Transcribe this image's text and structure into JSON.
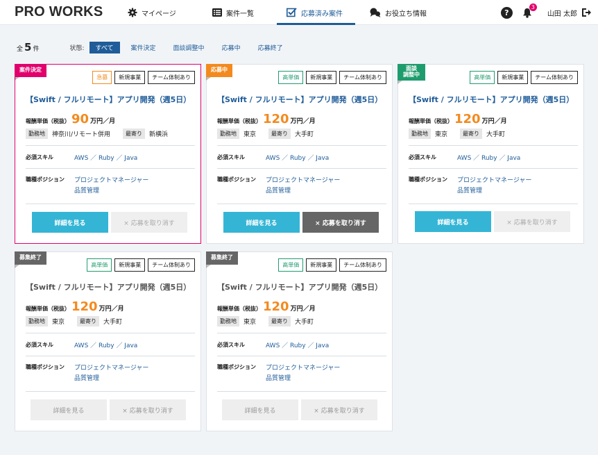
{
  "header": {
    "logo": "PRO WORKS",
    "nav": [
      {
        "label": "マイページ"
      },
      {
        "label": "案件一覧"
      },
      {
        "label": "応募済み案件"
      },
      {
        "label": "お役立ち情報"
      }
    ],
    "notification_count": "3",
    "user_name": "山田 太郎",
    "colors": {
      "accent": "#1f5c99",
      "alert": "#e2006d"
    }
  },
  "filter": {
    "total_prefix": "全",
    "total_count": "5",
    "total_suffix": "件",
    "status_label": "状態:",
    "chips": [
      "すべて",
      "案件決定",
      "面談調整中",
      "応募中",
      "応募終了"
    ]
  },
  "cards": [
    {
      "status": "案件決定",
      "tags": [
        "急募",
        "新規事業",
        "チーム体制あり"
      ],
      "title": "【Swift / フルリモート】アプリ開発（週5日）",
      "price_label": "報酬単価（税抜）",
      "price": "90",
      "price_unit": "万円／月",
      "location_label": "勤務地",
      "location": "神奈川/リモート併用",
      "station_label": "最寄り",
      "station": "新横浜",
      "skills_label": "必須スキル",
      "skills": "AWS ／ Ruby ／ Java",
      "position_label": "職種ポジション",
      "position1": "プロジェクトマネージャー",
      "position2": "品質管理",
      "detail_button": "詳細を見る",
      "cancel_button": "× 応募を取り消す"
    },
    {
      "status": "応募中",
      "tags": [
        "高単価",
        "新規事業",
        "チーム体制あり"
      ],
      "title": "【Swift / フルリモート】アプリ開発（週5日）",
      "price_label": "報酬単価（税抜）",
      "price": "120",
      "price_unit": "万円／月",
      "location_label": "勤務地",
      "location": "東京",
      "station_label": "最寄り",
      "station": "大手町",
      "skills_label": "必須スキル",
      "skills": "AWS ／ Ruby ／ Java",
      "position_label": "職種ポジション",
      "position1": "プロジェクトマネージャー",
      "position2": "品質管理",
      "detail_button": "詳細を見る",
      "cancel_button": "× 応募を取り消す"
    },
    {
      "status_line1": "面談",
      "status_line2": "調整中",
      "tags": [
        "高単価",
        "新規事業",
        "チーム体制あり"
      ],
      "title": "【Swift / フルリモート】アプリ開発（週5日）",
      "price_label": "報酬単価（税抜）",
      "price": "120",
      "price_unit": "万円／月",
      "location_label": "勤務地",
      "location": "東京",
      "station_label": "最寄り",
      "station": "大手町",
      "skills_label": "必須スキル",
      "skills": "AWS ／ Ruby ／ Java",
      "position_label": "職種ポジション",
      "position1": "プロジェクトマネージャー",
      "position2": "品質管理",
      "detail_button": "詳細を見る",
      "cancel_button": "× 応募を取り消す"
    },
    {
      "status": "募集終了",
      "tags": [
        "高単価",
        "新規事業",
        "チーム体制あり"
      ],
      "title": "【Swift / フルリモート】アプリ開発（週5日）",
      "price_label": "報酬単価（税抜）",
      "price": "120",
      "price_unit": "万円／月",
      "location_label": "勤務地",
      "location": "東京",
      "station_label": "最寄り",
      "station": "大手町",
      "skills_label": "必須スキル",
      "skills": "AWS ／ Ruby ／ Java",
      "position_label": "職種ポジション",
      "position1": "プロジェクトマネージャー",
      "position2": "品質管理",
      "detail_button": "詳細を見る",
      "cancel_button": "× 応募を取り消す"
    },
    {
      "status": "募集終了",
      "tags": [
        "高単価",
        "新規事業",
        "チーム体制あり"
      ],
      "title": "【Swift / フルリモート】アプリ開発（週5日）",
      "price_label": "報酬単価（税抜）",
      "price": "120",
      "price_unit": "万円／月",
      "location_label": "勤務地",
      "location": "東京",
      "station_label": "最寄り",
      "station": "大手町",
      "skills_label": "必須スキル",
      "skills": "AWS ／ Ruby ／ Java",
      "position_label": "職種ポジション",
      "position1": "プロジェクトマネージャー",
      "position2": "品質管理",
      "detail_button": "詳細を見る",
      "cancel_button": "× 応募を取り消す"
    }
  ]
}
